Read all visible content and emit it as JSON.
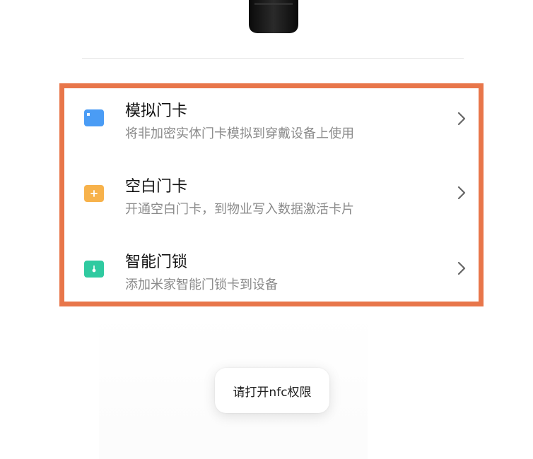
{
  "device": {
    "image_name": "wearable-device-image"
  },
  "highlight_color": "#e8764a",
  "menu": {
    "items": [
      {
        "title": "模拟门卡",
        "subtitle": "将非加密实体门卡模拟到穿戴设备上使用",
        "icon": "card-icon",
        "icon_color": "#4a9cf5"
      },
      {
        "title": "空白门卡",
        "subtitle": "开通空白门卡，到物业写入数据激活卡片",
        "icon": "blank-card-icon",
        "icon_color": "#f7b24b"
      },
      {
        "title": "智能门锁",
        "subtitle": "添加米家智能门锁卡到设备",
        "icon": "smart-lock-icon",
        "icon_color": "#2fcaa0"
      }
    ]
  },
  "toast": {
    "message": "请打开nfc权限"
  }
}
